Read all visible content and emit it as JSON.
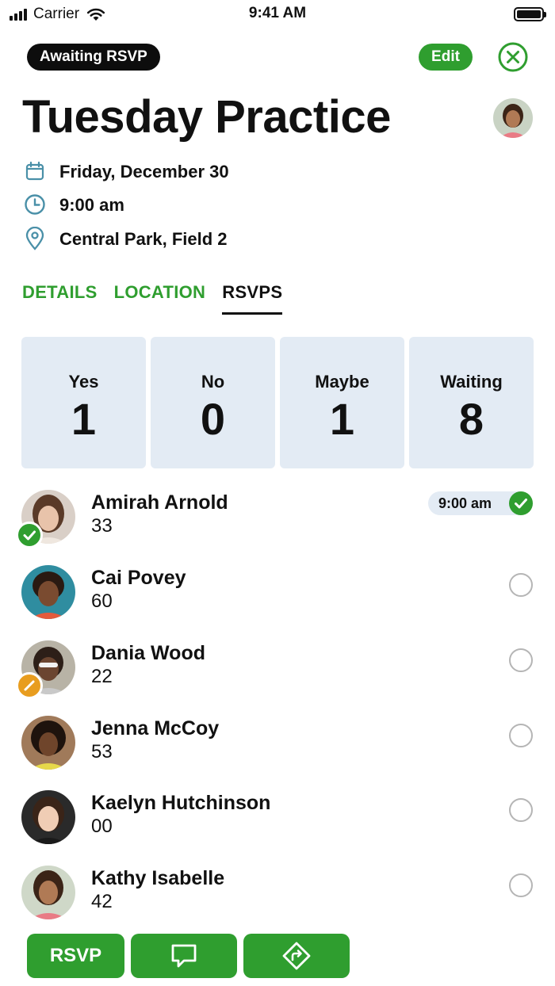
{
  "status_bar": {
    "carrier": "Carrier",
    "time": "9:41 AM"
  },
  "header": {
    "badge": "Awaiting RSVP",
    "edit_label": "Edit",
    "title": "Tuesday Practice"
  },
  "event": {
    "date": "Friday, December 30",
    "time": "9:00 am",
    "location": "Central Park, Field 2"
  },
  "tabs": [
    {
      "label": "DETAILS",
      "active": false
    },
    {
      "label": "LOCATION",
      "active": false
    },
    {
      "label": "RSVPS",
      "active": true
    }
  ],
  "stats": [
    {
      "label": "Yes",
      "value": "1"
    },
    {
      "label": "No",
      "value": "0"
    },
    {
      "label": "Maybe",
      "value": "1"
    },
    {
      "label": "Waiting",
      "value": "8"
    }
  ],
  "players": [
    {
      "name": "Amirah Arnold",
      "number": "33",
      "status": "yes",
      "rsvp_time": "9:00 am"
    },
    {
      "name": "Cai Povey",
      "number": "60",
      "status": "waiting"
    },
    {
      "name": "Dania Wood",
      "number": "22",
      "status": "maybe"
    },
    {
      "name": "Jenna McCoy",
      "number": "53",
      "status": "waiting"
    },
    {
      "name": "Kaelyn Hutchinson",
      "number": "00",
      "status": "waiting"
    },
    {
      "name": "Kathy Isabelle",
      "number": "42",
      "status": "waiting"
    }
  ],
  "actions": {
    "rsvp_label": "RSVP"
  },
  "colors": {
    "accent": "#2f9e2f",
    "card_bg": "#e3ebf4",
    "icon_teal": "#4a90a8",
    "maybe": "#e89d1f"
  },
  "icons": [
    "signal-icon",
    "wifi-icon",
    "battery-icon",
    "close-circle-icon",
    "calendar-icon",
    "clock-icon",
    "location-pin-icon",
    "check-icon",
    "slash-icon",
    "chat-icon",
    "directions-icon"
  ]
}
